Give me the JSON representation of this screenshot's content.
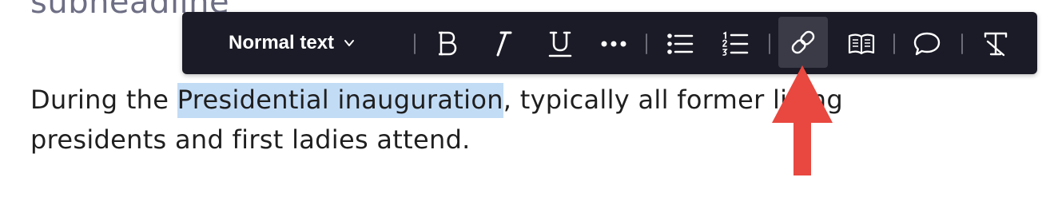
{
  "heading": {
    "subheadline": "subheadline"
  },
  "toolbar": {
    "text_style": "Normal text",
    "buttons": [
      {
        "name": "bold",
        "icon": "bold-icon"
      },
      {
        "name": "italic",
        "icon": "italic-icon"
      },
      {
        "name": "underline",
        "icon": "underline-icon"
      },
      {
        "name": "more",
        "icon": "more-icon"
      },
      {
        "name": "bulleted-list",
        "icon": "bulleted-list-icon"
      },
      {
        "name": "numbered-list",
        "icon": "numbered-list-icon"
      },
      {
        "name": "link",
        "icon": "link-icon",
        "active": true
      },
      {
        "name": "book",
        "icon": "book-icon"
      },
      {
        "name": "comment",
        "icon": "comment-icon"
      },
      {
        "name": "clear-formatting",
        "icon": "clear-formatting-icon"
      }
    ]
  },
  "content": {
    "before": "During the ",
    "selected": "Presidential inauguration",
    "after": ", typically all former living presidents and first ladies attend."
  },
  "colors": {
    "toolbar_bg": "#1a1b26",
    "selection": "#c3dcf6",
    "arrow": "#e8483f",
    "subheadline": "#6e6f85"
  }
}
